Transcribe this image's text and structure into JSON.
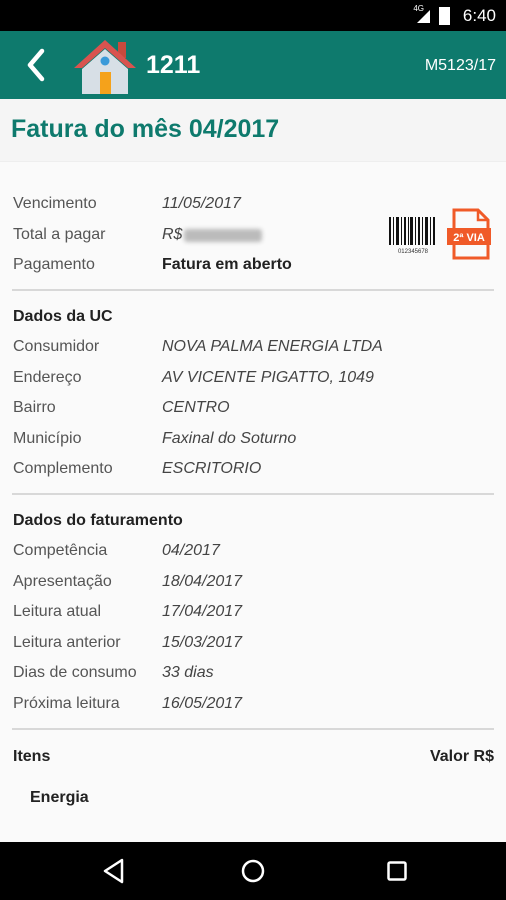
{
  "statusbar": {
    "time": "6:40",
    "network": "4G"
  },
  "header": {
    "uc_number": "1211",
    "code": "M5123/17"
  },
  "page_title": "Fatura do mês 04/2017",
  "summary": [
    {
      "label": "Vencimento",
      "value": "11/05/2017"
    },
    {
      "label": "Total a pagar",
      "value": "R$"
    },
    {
      "label": "Pagamento",
      "value": "Fatura em aberto"
    }
  ],
  "barcode_text": "012345678",
  "pdf_label": "2ª VIA",
  "uc_section": {
    "title": "Dados da UC",
    "rows": [
      {
        "label": "Consumidor",
        "value": "NOVA PALMA ENERGIA LTDA"
      },
      {
        "label": "Endereço",
        "value": "AV VICENTE PIGATTO, 1049"
      },
      {
        "label": "Bairro",
        "value": "CENTRO"
      },
      {
        "label": "Município",
        "value": "Faxinal do Soturno"
      },
      {
        "label": "Complemento",
        "value": "ESCRITORIO"
      }
    ]
  },
  "billing_section": {
    "title": "Dados do faturamento",
    "rows": [
      {
        "label": "Competência",
        "value": "04/2017"
      },
      {
        "label": "Apresentação",
        "value": "18/04/2017"
      },
      {
        "label": "Leitura atual",
        "value": "17/04/2017"
      },
      {
        "label": "Leitura anterior",
        "value": "15/03/2017"
      },
      {
        "label": "Dias de consumo",
        "value": "33 dias"
      },
      {
        "label": "Próxima leitura",
        "value": "16/05/2017"
      }
    ]
  },
  "items": {
    "title": "Itens",
    "value_header": "Valor R$",
    "group": "Energia"
  },
  "colors": {
    "primary": "#0e7a6d",
    "pdf": "#f05a28"
  }
}
